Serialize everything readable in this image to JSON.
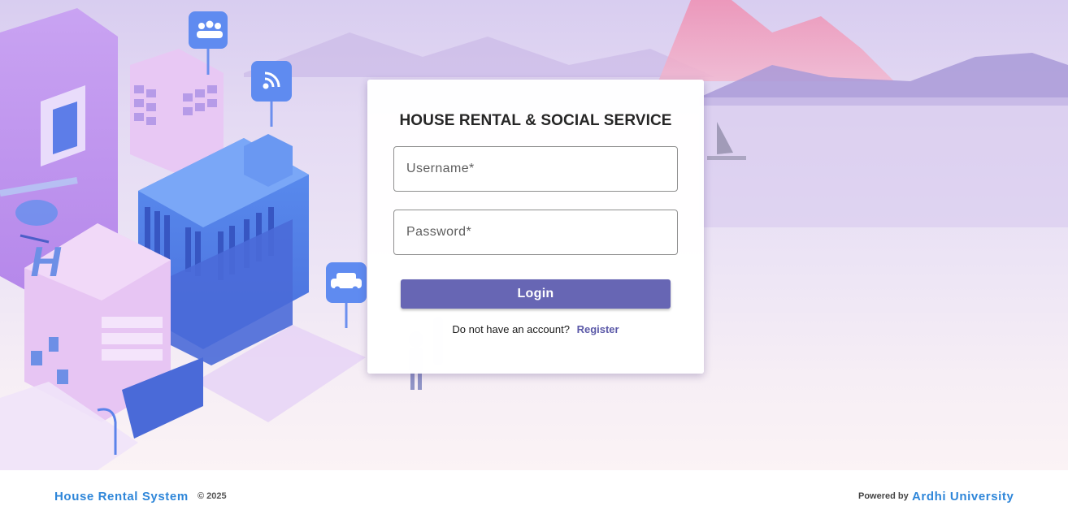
{
  "login": {
    "title": "HOUSE RENTAL & SOCIAL SERVICE",
    "username_placeholder": "Username*",
    "password_placeholder": "Password*",
    "login_label": "Login",
    "no_account_text": "Do not have an account?",
    "register_label": "Register"
  },
  "footer": {
    "brand": "House Rental System",
    "copyright": "© 2025",
    "powered_by": "Powered by",
    "university": "Ardhi University"
  },
  "colors": {
    "accent": "#6766b4",
    "footer_link": "#2e86d9"
  },
  "icons": [
    "users-icon",
    "wifi-icon",
    "car-icon"
  ]
}
